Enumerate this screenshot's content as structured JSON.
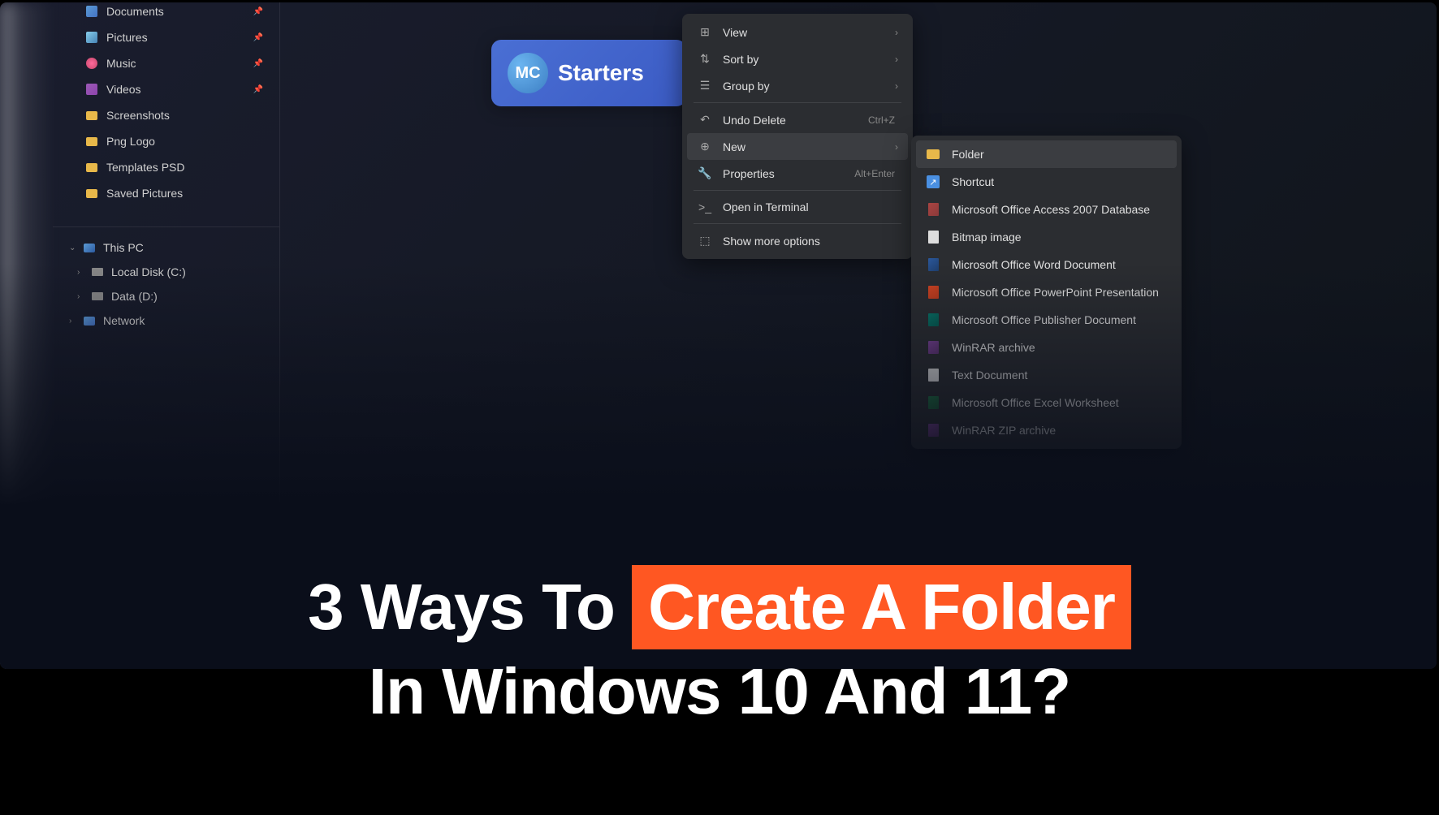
{
  "sidebar": {
    "pinned_items": [
      {
        "label": "Documents",
        "icon": "doc",
        "pinned": true
      },
      {
        "label": "Pictures",
        "icon": "pic",
        "pinned": true
      },
      {
        "label": "Music",
        "icon": "music",
        "pinned": true
      },
      {
        "label": "Videos",
        "icon": "video",
        "pinned": true
      },
      {
        "label": "Screenshots",
        "icon": "folder",
        "pinned": false
      },
      {
        "label": "Png Logo",
        "icon": "folder",
        "pinned": false
      },
      {
        "label": "Templates PSD",
        "icon": "folder",
        "pinned": false
      },
      {
        "label": "Saved Pictures",
        "icon": "folder",
        "pinned": false
      }
    ],
    "tree": {
      "this_pc": "This PC",
      "local_disk": "Local Disk (C:)",
      "data_disk": "Data (D:)",
      "network": "Network"
    }
  },
  "logo": {
    "initials": "MC",
    "text": "Starters"
  },
  "context_menu": {
    "view": "View",
    "sort_by": "Sort by",
    "group_by": "Group by",
    "undo_delete": "Undo Delete",
    "undo_delete_shortcut": "Ctrl+Z",
    "new": "New",
    "properties": "Properties",
    "properties_shortcut": "Alt+Enter",
    "open_terminal": "Open in Terminal",
    "show_more": "Show more options"
  },
  "submenu": {
    "folder": "Folder",
    "shortcut": "Shortcut",
    "access": "Microsoft Office Access 2007 Database",
    "bitmap": "Bitmap image",
    "word": "Microsoft Office Word Document",
    "powerpoint": "Microsoft Office PowerPoint Presentation",
    "publisher": "Microsoft Office Publisher Document",
    "winrar": "WinRAR archive",
    "text": "Text Document",
    "excel": "Microsoft Office Excel Worksheet",
    "winrar_zip": "WinRAR ZIP archive"
  },
  "title": {
    "line1_part1": "3 Ways To ",
    "line1_highlight": "Create A Folder",
    "line2": "In Windows 10 And 11?"
  }
}
